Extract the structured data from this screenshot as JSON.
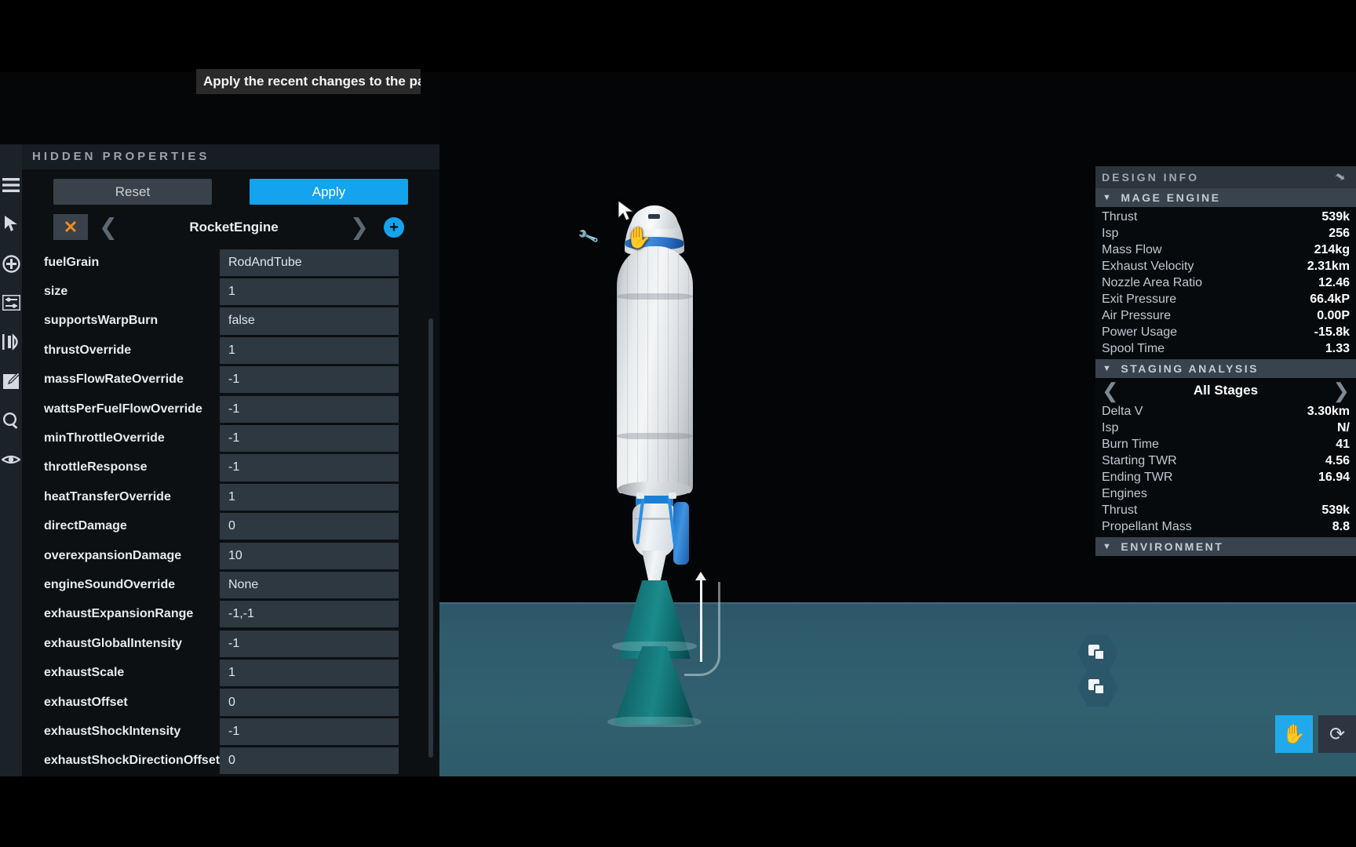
{
  "tooltip": {
    "text": "Apply the recent changes to the part"
  },
  "left_toolbar": {
    "items": [
      {
        "name": "menu-icon",
        "label": "Menu"
      },
      {
        "name": "cursor-icon",
        "label": "Select"
      },
      {
        "name": "add-part-icon",
        "label": "Add Part"
      },
      {
        "name": "sliders-icon",
        "label": "Part Properties"
      },
      {
        "name": "symmetry-icon",
        "label": "Symmetry"
      },
      {
        "name": "edit-icon",
        "label": "Edit"
      },
      {
        "name": "search-icon",
        "label": "Search"
      },
      {
        "name": "visibility-icon",
        "label": "Visibility"
      }
    ]
  },
  "panel": {
    "title": "HIDDEN PROPERTIES",
    "reset_label": "Reset",
    "apply_label": "Apply",
    "close_label": "✕",
    "prev_label": "❮",
    "next_label": "❯",
    "add_label": "+",
    "part_name": "RocketEngine",
    "properties": [
      {
        "key": "fuelGrain",
        "value": "RodAndTube"
      },
      {
        "key": "size",
        "value": "1"
      },
      {
        "key": "supportsWarpBurn",
        "value": "false"
      },
      {
        "key": "thrustOverride",
        "value": "1"
      },
      {
        "key": "massFlowRateOverride",
        "value": "-1"
      },
      {
        "key": "wattsPerFuelFlowOverride",
        "value": "-1"
      },
      {
        "key": "minThrottleOverride",
        "value": "-1"
      },
      {
        "key": "throttleResponse",
        "value": "-1"
      },
      {
        "key": "heatTransferOverride",
        "value": "1"
      },
      {
        "key": "directDamage",
        "value": "0"
      },
      {
        "key": "overexpansionDamage",
        "value": "10"
      },
      {
        "key": "engineSoundOverride",
        "value": "None"
      },
      {
        "key": "exhaustExpansionRange",
        "value": "-1,-1"
      },
      {
        "key": "exhaustGlobalIntensity",
        "value": "-1"
      },
      {
        "key": "exhaustScale",
        "value": "1"
      },
      {
        "key": "exhaustOffset",
        "value": "0"
      },
      {
        "key": "exhaustShockIntensity",
        "value": "-1"
      },
      {
        "key": "exhaustShockDirectionOffset",
        "value": "0"
      }
    ]
  },
  "design_info": {
    "title": "DESIGN INFO",
    "pin_icon": "📌",
    "sections": [
      {
        "title": "MAGE ENGINE",
        "rows": [
          {
            "label": "Thrust",
            "value": "539k"
          },
          {
            "label": "Isp",
            "value": "256"
          },
          {
            "label": "Mass Flow",
            "value": "214kg"
          },
          {
            "label": "Exhaust Velocity",
            "value": "2.31km"
          },
          {
            "label": "Nozzle Area Ratio",
            "value": "12.46"
          },
          {
            "label": "Exit Pressure",
            "value": "66.4kP"
          },
          {
            "label": "Air Pressure",
            "value": "0.00P"
          },
          {
            "label": "Power Usage",
            "value": "-15.8k"
          },
          {
            "label": "Spool Time",
            "value": "1.33"
          }
        ]
      },
      {
        "title": "STAGING ANALYSIS",
        "stage_selector": {
          "prev": "❮",
          "label": "All Stages",
          "next": "❯"
        },
        "rows": [
          {
            "label": "Delta V",
            "value": "3.30km"
          },
          {
            "label": "Isp",
            "value": "N/"
          },
          {
            "label": "Burn Time",
            "value": "41"
          },
          {
            "label": "Starting TWR",
            "value": "4.56"
          },
          {
            "label": "Ending TWR",
            "value": "16.94"
          },
          {
            "label": "Engines",
            "value": ""
          },
          {
            "label": "Thrust",
            "value": "539k"
          },
          {
            "label": "Propellant Mass",
            "value": "8.8"
          }
        ]
      },
      {
        "title": "ENVIRONMENT",
        "rows": []
      }
    ]
  },
  "viewport": {
    "duplicate_buttons": [
      {
        "name": "duplicate-part-button-1"
      },
      {
        "name": "duplicate-part-button-2"
      }
    ],
    "tools": [
      {
        "name": "pan-tool",
        "glyph": "✋",
        "active": true
      },
      {
        "name": "rotate-tool",
        "glyph": "⟳",
        "active": false
      }
    ]
  },
  "colors": {
    "accent_blue": "#14a3ee",
    "close_orange": "#f08a1e",
    "panel_bg": "#0c1013",
    "field_bg": "#2d3841",
    "ground": "#31606f"
  }
}
